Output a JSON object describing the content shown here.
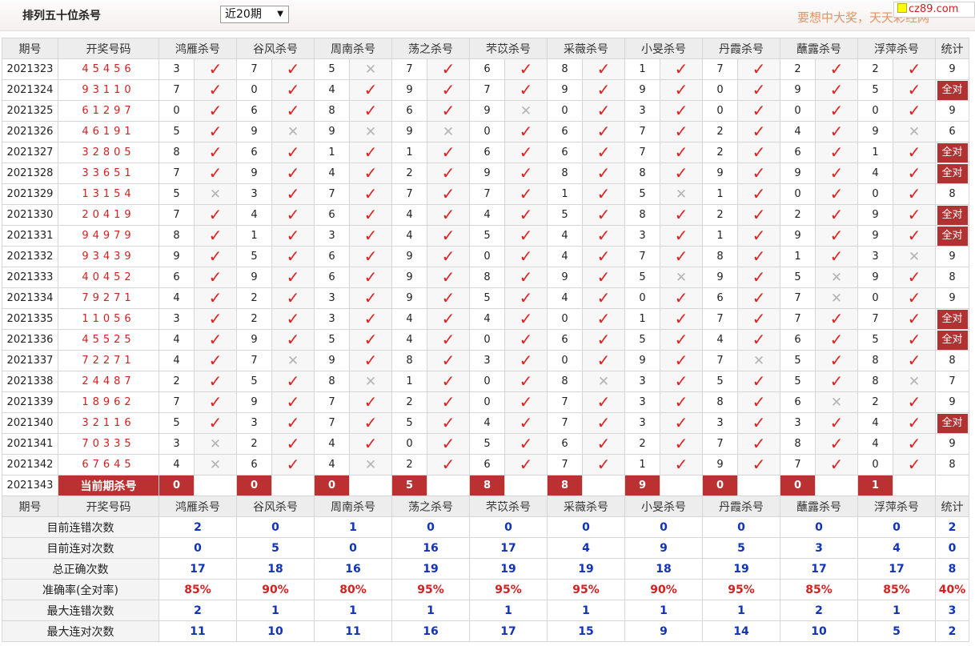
{
  "header": {
    "title": "排列五十位杀号",
    "period_select": "近20期",
    "slogan": "要想中大奖，天天彩经网",
    "logo": "cz89.com"
  },
  "columns": [
    "期号",
    "开奖号码",
    "鸿雁杀号",
    "谷风杀号",
    "周南杀号",
    "荡之杀号",
    "芣苡杀号",
    "采薇杀号",
    "小旻杀号",
    "丹霞杀号",
    "蘸露杀号",
    "浮萍杀号",
    "统计"
  ],
  "rows": [
    {
      "period": "2021323",
      "numbers": "45456",
      "kills": [
        [
          "3",
          "y"
        ],
        [
          "7",
          "y"
        ],
        [
          "5",
          "n"
        ],
        [
          "7",
          "y"
        ],
        [
          "6",
          "y"
        ],
        [
          "8",
          "y"
        ],
        [
          "1",
          "y"
        ],
        [
          "7",
          "y"
        ],
        [
          "2",
          "y"
        ],
        [
          "2",
          "y"
        ]
      ],
      "stat": "9"
    },
    {
      "period": "2021324",
      "numbers": "93110",
      "kills": [
        [
          "7",
          "y"
        ],
        [
          "0",
          "y"
        ],
        [
          "4",
          "y"
        ],
        [
          "9",
          "y"
        ],
        [
          "7",
          "y"
        ],
        [
          "9",
          "y"
        ],
        [
          "9",
          "y"
        ],
        [
          "0",
          "y"
        ],
        [
          "9",
          "y"
        ],
        [
          "5",
          "y"
        ]
      ],
      "stat": "全对"
    },
    {
      "period": "2021325",
      "numbers": "61297",
      "kills": [
        [
          "0",
          "y"
        ],
        [
          "6",
          "y"
        ],
        [
          "8",
          "y"
        ],
        [
          "6",
          "y"
        ],
        [
          "9",
          "n"
        ],
        [
          "0",
          "y"
        ],
        [
          "3",
          "y"
        ],
        [
          "0",
          "y"
        ],
        [
          "0",
          "y"
        ],
        [
          "0",
          "y"
        ]
      ],
      "stat": "9"
    },
    {
      "period": "2021326",
      "numbers": "46191",
      "kills": [
        [
          "5",
          "y"
        ],
        [
          "9",
          "n"
        ],
        [
          "9",
          "n"
        ],
        [
          "9",
          "n"
        ],
        [
          "0",
          "y"
        ],
        [
          "6",
          "y"
        ],
        [
          "7",
          "y"
        ],
        [
          "2",
          "y"
        ],
        [
          "4",
          "y"
        ],
        [
          "9",
          "n"
        ]
      ],
      "stat": "6"
    },
    {
      "period": "2021327",
      "numbers": "32805",
      "kills": [
        [
          "8",
          "y"
        ],
        [
          "6",
          "y"
        ],
        [
          "1",
          "y"
        ],
        [
          "1",
          "y"
        ],
        [
          "6",
          "y"
        ],
        [
          "6",
          "y"
        ],
        [
          "7",
          "y"
        ],
        [
          "2",
          "y"
        ],
        [
          "6",
          "y"
        ],
        [
          "1",
          "y"
        ]
      ],
      "stat": "全对"
    },
    {
      "period": "2021328",
      "numbers": "33651",
      "kills": [
        [
          "7",
          "y"
        ],
        [
          "9",
          "y"
        ],
        [
          "4",
          "y"
        ],
        [
          "2",
          "y"
        ],
        [
          "9",
          "y"
        ],
        [
          "8",
          "y"
        ],
        [
          "8",
          "y"
        ],
        [
          "9",
          "y"
        ],
        [
          "9",
          "y"
        ],
        [
          "4",
          "y"
        ]
      ],
      "stat": "全对"
    },
    {
      "period": "2021329",
      "numbers": "13154",
      "kills": [
        [
          "5",
          "n"
        ],
        [
          "3",
          "y"
        ],
        [
          "7",
          "y"
        ],
        [
          "7",
          "y"
        ],
        [
          "7",
          "y"
        ],
        [
          "1",
          "y"
        ],
        [
          "5",
          "n"
        ],
        [
          "1",
          "y"
        ],
        [
          "0",
          "y"
        ],
        [
          "0",
          "y"
        ]
      ],
      "stat": "8"
    },
    {
      "period": "2021330",
      "numbers": "20419",
      "kills": [
        [
          "7",
          "y"
        ],
        [
          "4",
          "y"
        ],
        [
          "6",
          "y"
        ],
        [
          "4",
          "y"
        ],
        [
          "4",
          "y"
        ],
        [
          "5",
          "y"
        ],
        [
          "8",
          "y"
        ],
        [
          "2",
          "y"
        ],
        [
          "2",
          "y"
        ],
        [
          "9",
          "y"
        ]
      ],
      "stat": "全对"
    },
    {
      "period": "2021331",
      "numbers": "94979",
      "kills": [
        [
          "8",
          "y"
        ],
        [
          "1",
          "y"
        ],
        [
          "3",
          "y"
        ],
        [
          "4",
          "y"
        ],
        [
          "5",
          "y"
        ],
        [
          "4",
          "y"
        ],
        [
          "3",
          "y"
        ],
        [
          "1",
          "y"
        ],
        [
          "9",
          "y"
        ],
        [
          "9",
          "y"
        ]
      ],
      "stat": "全对"
    },
    {
      "period": "2021332",
      "numbers": "93439",
      "kills": [
        [
          "9",
          "y"
        ],
        [
          "5",
          "y"
        ],
        [
          "6",
          "y"
        ],
        [
          "9",
          "y"
        ],
        [
          "0",
          "y"
        ],
        [
          "4",
          "y"
        ],
        [
          "7",
          "y"
        ],
        [
          "8",
          "y"
        ],
        [
          "1",
          "y"
        ],
        [
          "3",
          "n"
        ]
      ],
      "stat": "9"
    },
    {
      "period": "2021333",
      "numbers": "40452",
      "kills": [
        [
          "6",
          "y"
        ],
        [
          "9",
          "y"
        ],
        [
          "6",
          "y"
        ],
        [
          "9",
          "y"
        ],
        [
          "8",
          "y"
        ],
        [
          "9",
          "y"
        ],
        [
          "5",
          "n"
        ],
        [
          "9",
          "y"
        ],
        [
          "5",
          "n"
        ],
        [
          "9",
          "y"
        ]
      ],
      "stat": "8"
    },
    {
      "period": "2021334",
      "numbers": "79271",
      "kills": [
        [
          "4",
          "y"
        ],
        [
          "2",
          "y"
        ],
        [
          "3",
          "y"
        ],
        [
          "9",
          "y"
        ],
        [
          "5",
          "y"
        ],
        [
          "4",
          "y"
        ],
        [
          "0",
          "y"
        ],
        [
          "6",
          "y"
        ],
        [
          "7",
          "n"
        ],
        [
          "0",
          "y"
        ]
      ],
      "stat": "9"
    },
    {
      "period": "2021335",
      "numbers": "11056",
      "kills": [
        [
          "3",
          "y"
        ],
        [
          "2",
          "y"
        ],
        [
          "3",
          "y"
        ],
        [
          "4",
          "y"
        ],
        [
          "4",
          "y"
        ],
        [
          "0",
          "y"
        ],
        [
          "1",
          "y"
        ],
        [
          "7",
          "y"
        ],
        [
          "7",
          "y"
        ],
        [
          "7",
          "y"
        ]
      ],
      "stat": "全对"
    },
    {
      "period": "2021336",
      "numbers": "45525",
      "kills": [
        [
          "4",
          "y"
        ],
        [
          "9",
          "y"
        ],
        [
          "5",
          "y"
        ],
        [
          "4",
          "y"
        ],
        [
          "0",
          "y"
        ],
        [
          "6",
          "y"
        ],
        [
          "5",
          "y"
        ],
        [
          "4",
          "y"
        ],
        [
          "6",
          "y"
        ],
        [
          "5",
          "y"
        ]
      ],
      "stat": "全对"
    },
    {
      "period": "2021337",
      "numbers": "72271",
      "kills": [
        [
          "4",
          "y"
        ],
        [
          "7",
          "n"
        ],
        [
          "9",
          "y"
        ],
        [
          "8",
          "y"
        ],
        [
          "3",
          "y"
        ],
        [
          "0",
          "y"
        ],
        [
          "9",
          "y"
        ],
        [
          "7",
          "n"
        ],
        [
          "5",
          "y"
        ],
        [
          "8",
          "y"
        ]
      ],
      "stat": "8"
    },
    {
      "period": "2021338",
      "numbers": "24487",
      "kills": [
        [
          "2",
          "y"
        ],
        [
          "5",
          "y"
        ],
        [
          "8",
          "n"
        ],
        [
          "1",
          "y"
        ],
        [
          "0",
          "y"
        ],
        [
          "8",
          "n"
        ],
        [
          "3",
          "y"
        ],
        [
          "5",
          "y"
        ],
        [
          "5",
          "y"
        ],
        [
          "8",
          "n"
        ]
      ],
      "stat": "7"
    },
    {
      "period": "2021339",
      "numbers": "18962",
      "kills": [
        [
          "7",
          "y"
        ],
        [
          "9",
          "y"
        ],
        [
          "7",
          "y"
        ],
        [
          "2",
          "y"
        ],
        [
          "0",
          "y"
        ],
        [
          "7",
          "y"
        ],
        [
          "3",
          "y"
        ],
        [
          "8",
          "y"
        ],
        [
          "6",
          "n"
        ],
        [
          "2",
          "y"
        ]
      ],
      "stat": "9"
    },
    {
      "period": "2021340",
      "numbers": "32116",
      "kills": [
        [
          "5",
          "y"
        ],
        [
          "3",
          "y"
        ],
        [
          "7",
          "y"
        ],
        [
          "5",
          "y"
        ],
        [
          "4",
          "y"
        ],
        [
          "7",
          "y"
        ],
        [
          "3",
          "y"
        ],
        [
          "3",
          "y"
        ],
        [
          "3",
          "y"
        ],
        [
          "4",
          "y"
        ]
      ],
      "stat": "全对"
    },
    {
      "period": "2021341",
      "numbers": "70335",
      "kills": [
        [
          "3",
          "n"
        ],
        [
          "2",
          "y"
        ],
        [
          "4",
          "y"
        ],
        [
          "0",
          "y"
        ],
        [
          "5",
          "y"
        ],
        [
          "6",
          "y"
        ],
        [
          "2",
          "y"
        ],
        [
          "7",
          "y"
        ],
        [
          "8",
          "y"
        ],
        [
          "4",
          "y"
        ]
      ],
      "stat": "9"
    },
    {
      "period": "2021342",
      "numbers": "67645",
      "kills": [
        [
          "4",
          "n"
        ],
        [
          "6",
          "y"
        ],
        [
          "4",
          "n"
        ],
        [
          "2",
          "y"
        ],
        [
          "6",
          "y"
        ],
        [
          "7",
          "y"
        ],
        [
          "1",
          "y"
        ],
        [
          "9",
          "y"
        ],
        [
          "7",
          "y"
        ],
        [
          "0",
          "y"
        ]
      ],
      "stat": "8"
    }
  ],
  "current": {
    "period": "2021343",
    "label": "当前期杀号",
    "kills": [
      "0",
      "0",
      "0",
      "5",
      "8",
      "8",
      "9",
      "0",
      "0",
      "1"
    ]
  },
  "stats": [
    {
      "label": "目前连错次数",
      "values": [
        "2",
        "0",
        "1",
        "0",
        "0",
        "0",
        "0",
        "0",
        "0",
        "0",
        "2"
      ],
      "red": false
    },
    {
      "label": "目前连对次数",
      "values": [
        "0",
        "5",
        "0",
        "16",
        "17",
        "4",
        "9",
        "5",
        "3",
        "4",
        "0"
      ],
      "red": false
    },
    {
      "label": "总正确次数",
      "values": [
        "17",
        "18",
        "16",
        "19",
        "19",
        "19",
        "18",
        "19",
        "17",
        "17",
        "8"
      ],
      "red": false
    },
    {
      "label": "准确率(全对率)",
      "values": [
        "85%",
        "90%",
        "80%",
        "95%",
        "95%",
        "95%",
        "90%",
        "95%",
        "85%",
        "85%",
        "40%"
      ],
      "red": true
    },
    {
      "label": "最大连错次数",
      "values": [
        "2",
        "1",
        "1",
        "1",
        "1",
        "1",
        "1",
        "1",
        "2",
        "1",
        "3"
      ],
      "red": false
    },
    {
      "label": "最大连对次数",
      "values": [
        "11",
        "10",
        "11",
        "16",
        "17",
        "15",
        "9",
        "14",
        "10",
        "5",
        "2"
      ],
      "red": false
    }
  ],
  "icons": {
    "correct": "check-icon",
    "wrong": "cross-icon"
  },
  "colors": {
    "accent_red": "#bb3131",
    "check_red": "#e02020",
    "stat_blue": "#1133bb",
    "slogan": "#e8925c"
  }
}
